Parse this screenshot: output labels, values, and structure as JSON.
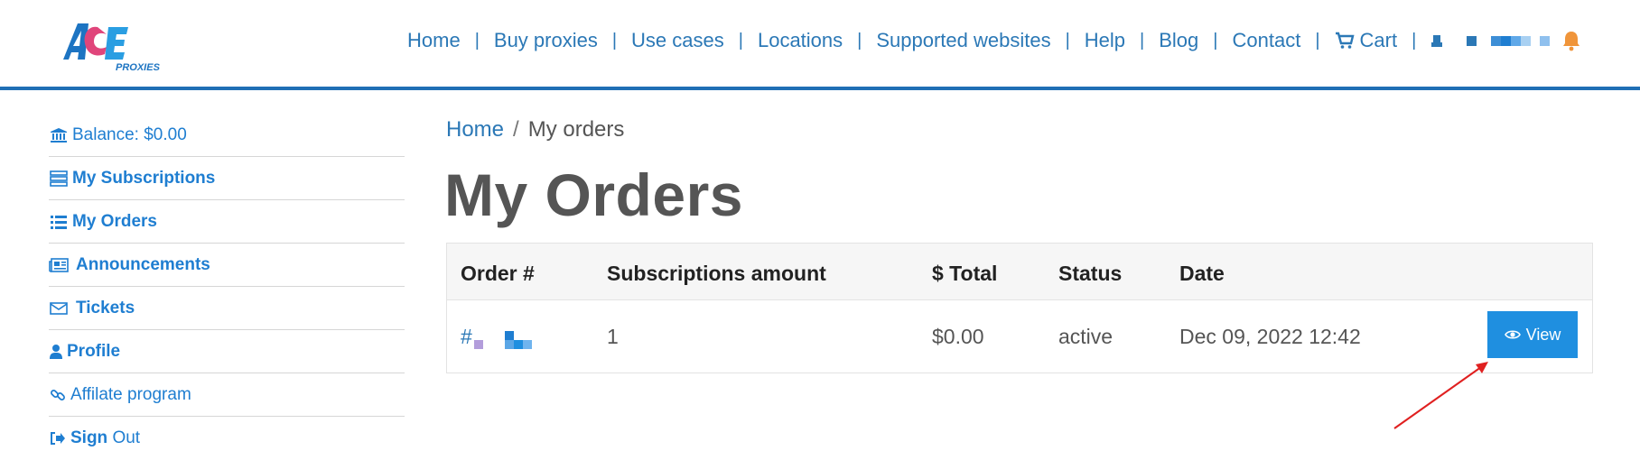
{
  "brand": {
    "logo_text": "ACE",
    "logo_subtext": "PROXIES",
    "primary_color": "#1f6fb5",
    "accent_color": "#e0457b"
  },
  "nav": {
    "items": [
      "Home",
      "Buy proxies",
      "Use cases",
      "Locations",
      "Supported websites",
      "Help",
      "Blog",
      "Contact"
    ],
    "cart_label": "Cart",
    "cart_icon": "cart-icon",
    "user_icon": "user-icon",
    "bell_icon": "bell-icon",
    "separator": "|"
  },
  "sidebar": {
    "items": [
      {
        "icon": "bank-icon",
        "label": "Balance: $0.00"
      },
      {
        "icon": "server-icon",
        "label": "My Subscriptions"
      },
      {
        "icon": "list-icon",
        "label": "My Orders"
      },
      {
        "icon": "newspaper-icon",
        "label": "Announcements"
      },
      {
        "icon": "envelope-icon",
        "label": "Tickets"
      },
      {
        "icon": "user-icon",
        "label": "Profile"
      },
      {
        "icon": "link-icon",
        "label": "Affilate program"
      },
      {
        "icon": "sign-out-icon",
        "label_bold": "Sign",
        "label_rest": " Out"
      }
    ]
  },
  "breadcrumb": {
    "home": "Home",
    "separator": "/",
    "current": "My orders"
  },
  "page": {
    "title": "My Orders"
  },
  "orders_table": {
    "headers": [
      "Order #",
      "Subscriptions amount",
      "$ Total",
      "Status",
      "Date"
    ],
    "rows": [
      {
        "order": "#",
        "subscriptions": "1",
        "total": "$0.00",
        "status": "active",
        "date": "Dec 09, 2022 12:42",
        "action": "View"
      }
    ],
    "view_button_color": "#1f8fe0"
  },
  "annotation": {
    "arrow_color": "#e02020"
  }
}
